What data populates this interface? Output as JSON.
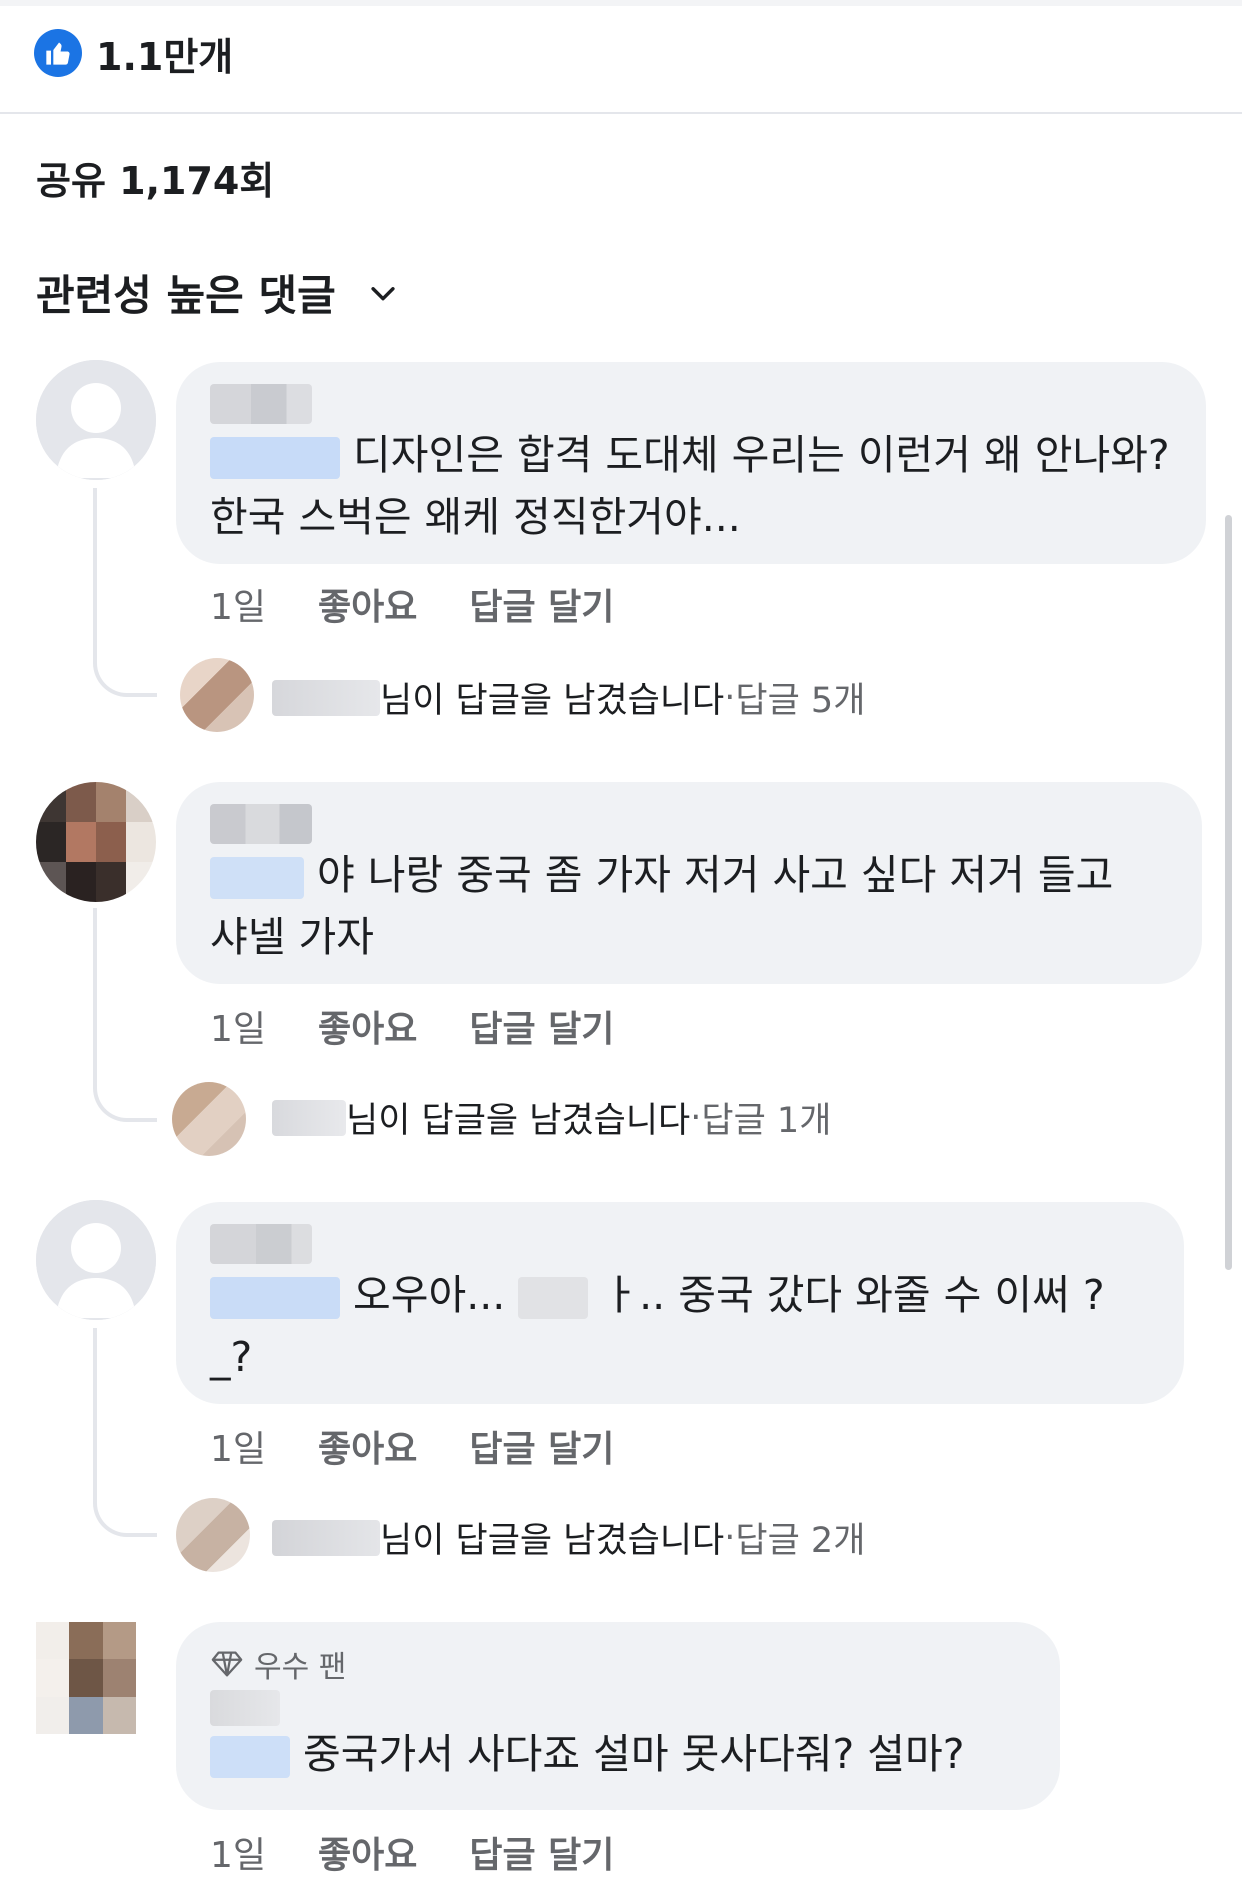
{
  "reactions": {
    "icon": "thumbs-up-icon",
    "count": "1.1만개",
    "color": "#1b74e4"
  },
  "shares": {
    "label": "공유 1,174회"
  },
  "sort": {
    "label": "관련성 높은 댓글",
    "icon": "chevron-down-icon"
  },
  "comments": [
    {
      "text": "디자인은 합격 도대체 우리는 이런거 왜 안나와? 한국 스벅은 왜케 정직한거야...",
      "time": "1일",
      "like": "좋아요",
      "reply": "답글 달기",
      "reply_summary": {
        "author_suffix": "님이 답글을 남겼습니다",
        "sep": " · ",
        "count": "답글 5개"
      }
    },
    {
      "text": "야 나랑 중국 좀 가자 저거 사고 싶다 저거 들고 샤넬 가자",
      "time": "1일",
      "like": "좋아요",
      "reply": "답글 달기",
      "reply_summary": {
        "author_suffix": "님이 답글을 남겼습니다",
        "sep": " · ",
        "count": "답글 1개"
      }
    },
    {
      "text_a": "오우아...",
      "text_b": "ㅏ.. 중국 갔다 와줄 수 이써 ?",
      "text_c": "_?",
      "time": "1일",
      "like": "좋아요",
      "reply": "답글 달기",
      "reply_summary": {
        "author_suffix": "님이 답글을 남겼습니다",
        "sep": " · ",
        "count": "답글 2개"
      }
    },
    {
      "badge": "우수 팬",
      "badge_icon": "diamond-icon",
      "text": "중국가서 사다죠 설마 못사다줘? 설마?",
      "time": "1일",
      "like": "좋아요",
      "reply": "답글 달기"
    }
  ]
}
